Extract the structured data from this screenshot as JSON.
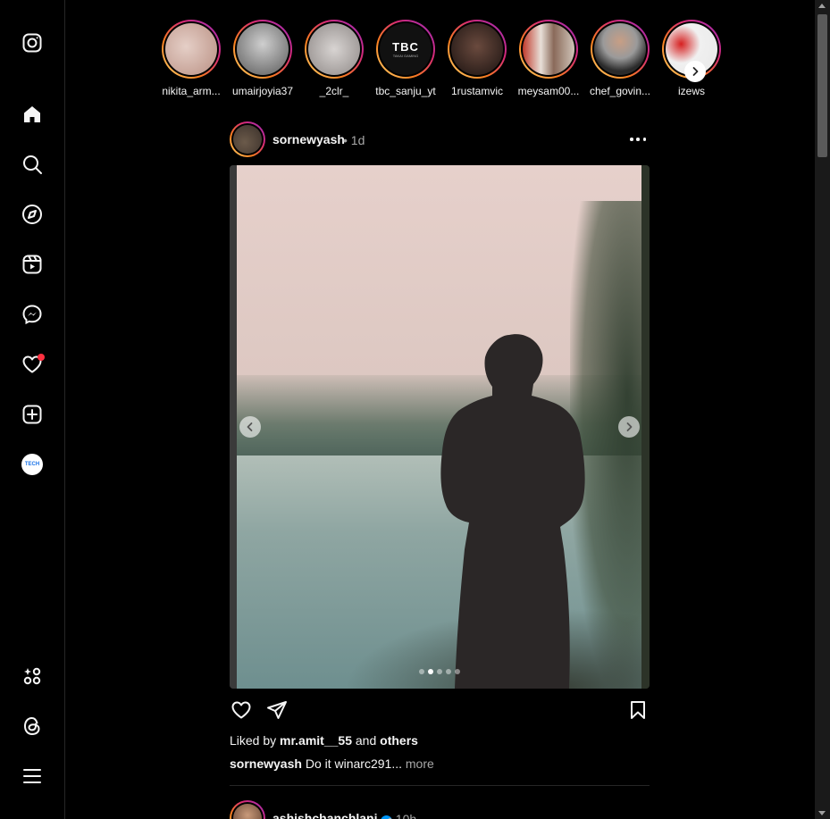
{
  "sidebar": {
    "items": [
      {
        "name": "instagram-logo-icon"
      },
      {
        "name": "home-icon"
      },
      {
        "name": "search-icon"
      },
      {
        "name": "explore-icon"
      },
      {
        "name": "reels-icon"
      },
      {
        "name": "messenger-icon"
      },
      {
        "name": "notifications-heart-icon"
      },
      {
        "name": "create-icon"
      },
      {
        "name": "profile-avatar"
      },
      {
        "name": "meta-ai-icon"
      },
      {
        "name": "threads-icon"
      },
      {
        "name": "menu-icon"
      }
    ],
    "profile_badge_text": "TECH"
  },
  "stories": [
    {
      "username": "nikita_arm...",
      "color": "#c9a79a"
    },
    {
      "username": "umairjoyia37",
      "color": "#8a8a8a"
    },
    {
      "username": "_2clr_",
      "color": "#b9b4b2"
    },
    {
      "username": "tbc_sanju_yt",
      "color": "#111111",
      "logo_text": "TBC",
      "logo_sub": "TAKAI GAMING"
    },
    {
      "username": "1rustamvic",
      "color": "#3a2a24"
    },
    {
      "username": "meysam00...",
      "color": "#b07a6a"
    },
    {
      "username": "chef_govin...",
      "color": "#6a6a6a"
    },
    {
      "username": "izews",
      "color": "#e8e8e8"
    }
  ],
  "post": {
    "username": "sornewyash",
    "time": "• 1d",
    "liked_by_prefix": "Liked by",
    "liked_by_user": "mr.amit__55",
    "liked_by_and": "and",
    "liked_by_others": "others",
    "caption_user": "sornewyash",
    "caption_text": "Do it winarc291...",
    "caption_more": "more",
    "carousel_count": 5,
    "carousel_active": 1
  },
  "post2": {
    "username": "ashishchanchlani",
    "time": "• 10h",
    "verified": true
  },
  "colors": {
    "background": "#000000",
    "text": "#f5f5f5",
    "secondary_text": "#a8a8a8",
    "notification": "#ff3040",
    "verified": "#0095f6"
  }
}
